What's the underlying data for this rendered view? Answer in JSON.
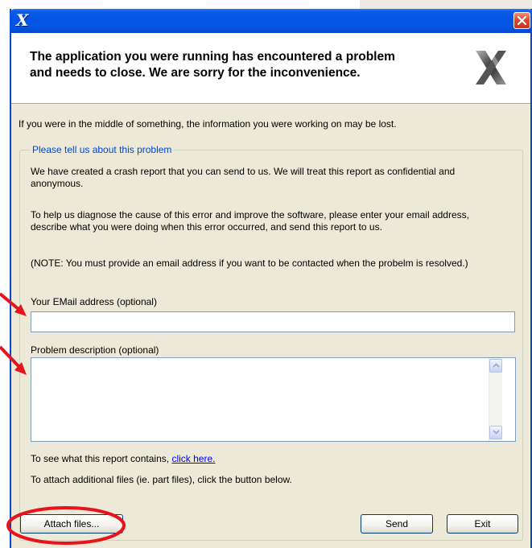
{
  "window": {
    "title_logo": "X",
    "close_glyph": "✕"
  },
  "header": {
    "message_line1": "The application you were running has encountered a problem",
    "message_line2": "and needs to close.  We are sorry for the inconvenience.",
    "logo_icon": "x-logo-icon"
  },
  "intro": "If you were in the middle of something, the information you were working on may be lost.",
  "group": {
    "legend": "Please tell us about this problem",
    "para1": "We have created a crash report that you can send to us.  We will treat this report as confidential and anonymous.",
    "para2": "To help us diagnose the cause of this error and improve the software, please enter your email address, describe what you were doing when this error occurred, and send this report to us.",
    "note": "(NOTE: You must provide an email address if you want to be contacted when the probelm is resolved.)",
    "email_label": "Your EMail address (optional)",
    "email_value": "",
    "description_label": "Problem description (optional)",
    "description_value": "",
    "report_text": "To see what this report contains, ",
    "report_link": "click here.",
    "attach_text": "To attach additional files (ie. part files), click the button below."
  },
  "buttons": {
    "attach": "Attach files...",
    "send": "Send",
    "exit": "Exit"
  },
  "colors": {
    "titlebar": "#0453e4",
    "dialog_bg": "#ece9d8",
    "legend": "#0046d5",
    "link": "#0000ff",
    "annotation": "#e8141b"
  }
}
